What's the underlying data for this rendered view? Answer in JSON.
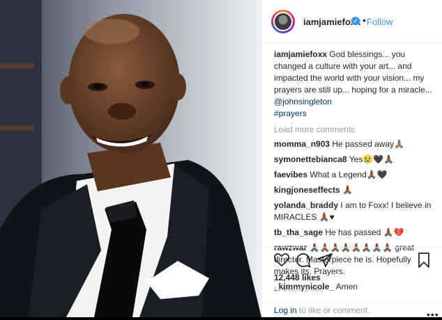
{
  "header": {
    "username": "iamjamiefoxx",
    "separator": "•",
    "follow_label": "Follow",
    "verified_glyph": "✓"
  },
  "caption": {
    "username": "iamjamiefoxx",
    "text": " God blessings... you changed a culture with your art... and impacted the world with your vision... my prayers are still up... hoping for a miracle... ",
    "mention": "@johnsingleton",
    "hashtag": "#prayers"
  },
  "load_more": "Load more comments",
  "comments": [
    {
      "user": "momma_n903",
      "text": " He passed away🙏🏽"
    },
    {
      "user": "symonettebianca8",
      "text": " Yes😢🖤🙏🏾"
    },
    {
      "user": "faevibes",
      "text": " What a Legend🙏🏾🖤"
    },
    {
      "user": "kingjoneseffects",
      "text": " 🙏🏾"
    },
    {
      "user": "yolanda_braddy",
      "text": " I am to Foxx! I believe in MIRACLES 🙏🏾♥"
    },
    {
      "user": "tb_tha_sage",
      "text": " He has passed 🙏🏾💔"
    },
    {
      "user": "rawzwar",
      "text": " 🙏🏾🙏🏾🙏🏾🙏🏾🙏🏾🙏🏾🙏🏾🙏🏾 great director. Masterpiece he is. Hopefully makes its. Prayers."
    },
    {
      "user": "_kimmynicole_",
      "text": " Amen"
    }
  ],
  "actions": {
    "likes": "12,448 likes",
    "timestamp": "54 MINUTES AGO"
  },
  "login": {
    "link": "Log in",
    "text": " to like or comment.",
    "more_glyph": "•••"
  },
  "icons": [
    "heart-icon",
    "comment-icon",
    "share-icon",
    "bookmark-icon"
  ],
  "colors": {
    "link": "#003569",
    "follow": "#3897f0",
    "muted": "#999999"
  }
}
